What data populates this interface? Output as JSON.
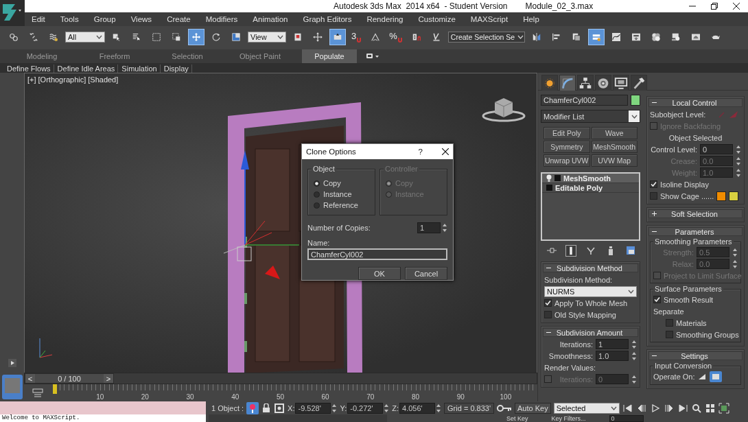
{
  "window": {
    "title": "Autodesk 3ds Max  2014 x64  - Student Version",
    "file": "Module_02_3.max"
  },
  "menu": [
    "Edit",
    "Tools",
    "Group",
    "Views",
    "Create",
    "Modifiers",
    "Animation",
    "Graph Editors",
    "Rendering",
    "Customize",
    "MAXScript",
    "Help"
  ],
  "toolbar": [
    {
      "kind": "link",
      "selected": false
    },
    {
      "kind": "unlink",
      "selected": false
    },
    {
      "kind": "bind",
      "selected": false
    },
    {
      "kind": "dropdown",
      "value": "All"
    },
    {
      "kind": "select",
      "selected": false
    },
    {
      "kind": "select_name",
      "selected": false
    },
    {
      "kind": "rect_region",
      "selected": false
    },
    {
      "kind": "window_crossing",
      "selected": false
    },
    {
      "kind": "move",
      "selected": true
    },
    {
      "kind": "rotate",
      "selected": false
    },
    {
      "kind": "scale",
      "selected": false
    },
    {
      "kind": "dropdown",
      "value": "View"
    },
    {
      "kind": "pivot",
      "selected": false
    },
    {
      "kind": "manipulate",
      "selected": false
    },
    {
      "kind": "keyboard",
      "selected": true
    },
    {
      "kind": "snap",
      "label": "3",
      "selected": false
    },
    {
      "kind": "angle_snap",
      "selected": false
    },
    {
      "kind": "percent_snap",
      "label": "%",
      "selected": false
    },
    {
      "kind": "spinner_snap",
      "selected": false
    },
    {
      "kind": "named_edit",
      "selected": false
    },
    {
      "kind": "named_selection",
      "value": "Create Selection Se"
    },
    {
      "kind": "mirror",
      "selected": false
    },
    {
      "kind": "align",
      "selected": false
    },
    {
      "kind": "explorer",
      "selected": false
    },
    {
      "kind": "layers",
      "selected": true
    },
    {
      "kind": "curve",
      "selected": false
    },
    {
      "kind": "schematic",
      "selected": false
    },
    {
      "kind": "material",
      "selected": false
    },
    {
      "kind": "render_setup",
      "selected": false
    },
    {
      "kind": "frame_window",
      "selected": false
    },
    {
      "kind": "render",
      "selected": false
    }
  ],
  "ribbon": {
    "tabs": [
      {
        "label": "Modeling",
        "selected": false
      },
      {
        "label": "Freeform",
        "selected": false
      },
      {
        "label": "Selection",
        "selected": false
      },
      {
        "label": "Object Paint",
        "selected": false
      },
      {
        "label": "Populate",
        "selected": true
      }
    ],
    "panels": [
      "Define Flows",
      "Define Idle Areas",
      "Simulation",
      "Display"
    ]
  },
  "viewport": {
    "labels": [
      "[+]",
      "[Orthographic]",
      "[Shaded]"
    ]
  },
  "dialog": {
    "title": "Clone Options",
    "help": "?",
    "groups": [
      {
        "title": "Object",
        "disabled": false,
        "options": [
          {
            "label": "Copy",
            "selected": true
          },
          {
            "label": "Instance",
            "selected": false
          },
          {
            "label": "Reference",
            "selected": false
          }
        ]
      },
      {
        "title": "Controller",
        "disabled": true,
        "options": [
          {
            "label": "Copy",
            "selected": true
          },
          {
            "label": "Instance",
            "selected": false
          }
        ]
      }
    ],
    "copies_label": "Number of Copies:",
    "copies": "1",
    "name_label": "Name:",
    "name": "ChamferCyl002",
    "buttons": [
      "OK",
      "Cancel"
    ]
  },
  "command_panel": {
    "tabs": [
      {
        "kind": "create",
        "selected": false
      },
      {
        "kind": "modify",
        "selected": true
      },
      {
        "kind": "hierarchy",
        "selected": false
      },
      {
        "kind": "motion",
        "selected": false
      },
      {
        "kind": "display",
        "selected": false
      },
      {
        "kind": "utilities",
        "selected": false
      }
    ],
    "object_name": "ChamferCyl002",
    "modifier_list": "Modifier List",
    "modifier_buttons": [
      "Edit Poly",
      "Wave",
      "Symmetry",
      "MeshSmooth",
      "Unwrap UVW",
      "UVW Map"
    ],
    "stack": [
      {
        "label": "MeshSmooth",
        "kind": "modifier",
        "selected": true
      },
      {
        "label": "Editable Poly",
        "kind": "base",
        "selected": false
      }
    ],
    "stack_tools": [
      {
        "kind": "pin",
        "on": false
      },
      {
        "kind": "end_result",
        "on": true
      },
      {
        "kind": "unique",
        "on": false
      },
      {
        "kind": "remove",
        "on": false
      },
      {
        "kind": "configure",
        "on": false
      }
    ],
    "left_rollouts": [
      {
        "title": "Subdivision Method",
        "expanded": true,
        "rows": [
          {
            "kind": "label",
            "text": "Subdivision Method:"
          },
          {
            "kind": "dropdown",
            "value": "NURMS"
          },
          {
            "kind": "checkbox",
            "label": "Apply To Whole Mesh",
            "checked": true,
            "disabled": false
          },
          {
            "kind": "checkbox",
            "label": "Old Style Mapping",
            "checked": false,
            "disabled": false
          }
        ]
      },
      {
        "title": "Subdivision Amount",
        "expanded": true,
        "rows": [
          {
            "kind": "spinner",
            "label": "Iterations:",
            "value": "1",
            "disabled": false
          },
          {
            "kind": "spinner",
            "label": "Smoothness:",
            "value": "1.0",
            "disabled": false
          },
          {
            "kind": "label",
            "text": "Render Values:"
          },
          {
            "kind": "check_spinner",
            "label": "Iterations:",
            "value": "0",
            "checked": false,
            "disabled": true
          }
        ]
      }
    ],
    "right_rollouts": [
      {
        "title": "Local Control",
        "expanded": true,
        "rows": [
          {
            "kind": "subobject",
            "label": "Subobject Level:"
          },
          {
            "kind": "checkbox",
            "label": "Ignore Backfacing",
            "checked": false,
            "disabled": true
          },
          {
            "kind": "note",
            "text": "Object Selected"
          },
          {
            "kind": "spinner",
            "label": "Control Level:",
            "value": "0",
            "disabled": false
          },
          {
            "kind": "spinner",
            "label": "Crease:",
            "value": "0.0",
            "disabled": true
          },
          {
            "kind": "spinner",
            "label": "Weight:",
            "value": "1.0",
            "disabled": true
          },
          {
            "kind": "checkbox",
            "label": "Isoline Display",
            "checked": true,
            "disabled": false
          },
          {
            "kind": "cage",
            "label": "Show Cage ......",
            "checked": false,
            "disabled": false
          }
        ]
      },
      {
        "title": "Soft Selection",
        "expanded": false
      },
      {
        "title": "Parameters",
        "expanded": true,
        "rows": [
          {
            "kind": "group",
            "title": "Smoothing Parameters",
            "rows": [
              {
                "kind": "spinner",
                "label": "Strength:",
                "value": "0.5",
                "disabled": true
              },
              {
                "kind": "spinner",
                "label": "Relax:",
                "value": "0.0",
                "disabled": true
              },
              {
                "kind": "checkbox",
                "label": "Project to Limit Surface",
                "checked": false,
                "disabled": true
              }
            ]
          },
          {
            "kind": "group",
            "title": "Surface Parameters",
            "rows": [
              {
                "kind": "checkbox",
                "label": "Smooth Result",
                "checked": true,
                "disabled": false
              },
              {
                "kind": "label",
                "text": "Separate",
                "children": [
                  {
                    "kind": "checkbox",
                    "label": "Materials",
                    "checked": false,
                    "disabled": false
                  },
                  {
                    "kind": "checkbox",
                    "label": "Smoothing Groups",
                    "checked": false,
                    "disabled": false
                  }
                ]
              }
            ]
          }
        ]
      },
      {
        "title": "Settings",
        "expanded": true,
        "rows": [
          {
            "kind": "group",
            "title": "Input Conversion",
            "rows": [
              {
                "kind": "operate",
                "label": "Operate On:"
              }
            ]
          }
        ]
      }
    ]
  },
  "timeline": {
    "frame": "0 / 100",
    "prev": "<",
    "next": ">",
    "level": 0,
    "ticks": [
      "10",
      "20",
      "30",
      "40",
      "50",
      "60",
      "70",
      "80",
      "90",
      "100"
    ]
  },
  "status": {
    "listener_output": "Welcome to MAXScript.",
    "selection": "1 Object :",
    "coords": [
      {
        "label": "X:",
        "value": "-9.528'"
      },
      {
        "label": "Y:",
        "value": "-0.272'"
      },
      {
        "label": "Z:",
        "value": "4.056'"
      }
    ],
    "grid": "Grid = 0.833'",
    "auto_key": "Auto Key",
    "key_mode": "Selected",
    "set_key": "Set Key",
    "key_filters": "Key Filters...",
    "frame": "0"
  }
}
